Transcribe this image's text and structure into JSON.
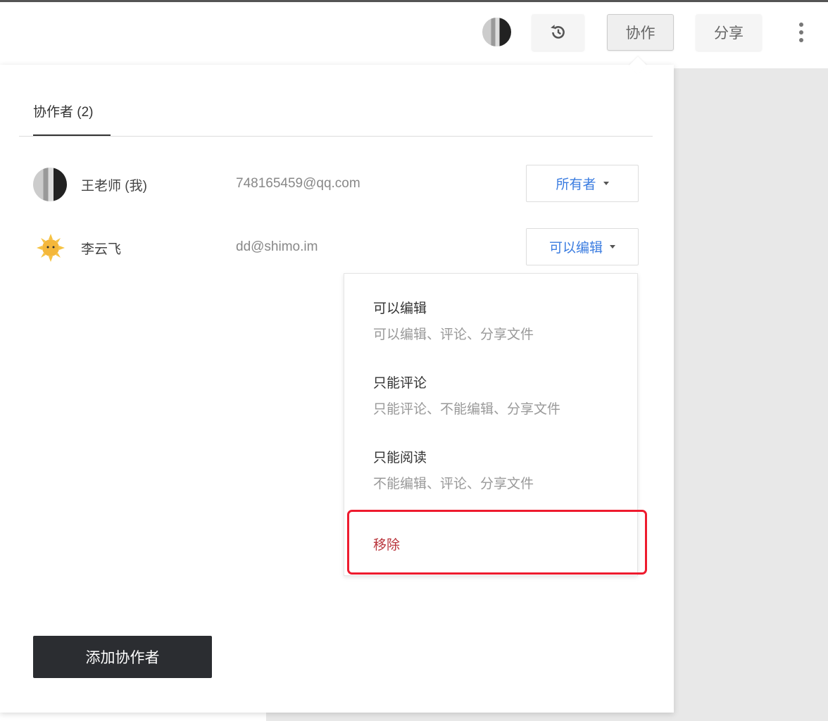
{
  "header": {
    "history_icon": "history-icon",
    "collaborate_label": "协作",
    "share_label": "分享",
    "more_icon": "more-vertical-icon"
  },
  "panel": {
    "tab_label": "协作者 (2)",
    "collaborators": [
      {
        "name": "王老师 (我)",
        "email": "748165459@qq.com",
        "role": "所有者"
      },
      {
        "name": "李云飞",
        "email": "dd@shimo.im",
        "role": "可以编辑"
      }
    ],
    "role_menu": {
      "options": [
        {
          "title": "可以编辑",
          "desc": "可以编辑、评论、分享文件"
        },
        {
          "title": "只能评论",
          "desc": "只能评论、不能编辑、分享文件"
        },
        {
          "title": "只能阅读",
          "desc": "不能编辑、评论、分享文件"
        }
      ],
      "remove_label": "移除"
    },
    "add_button_label": "添加协作者"
  },
  "colors": {
    "accent": "#3a7ce0",
    "remove": "#b9343b",
    "highlight": "#ee1b2e",
    "button_dark": "#2b2d31"
  }
}
